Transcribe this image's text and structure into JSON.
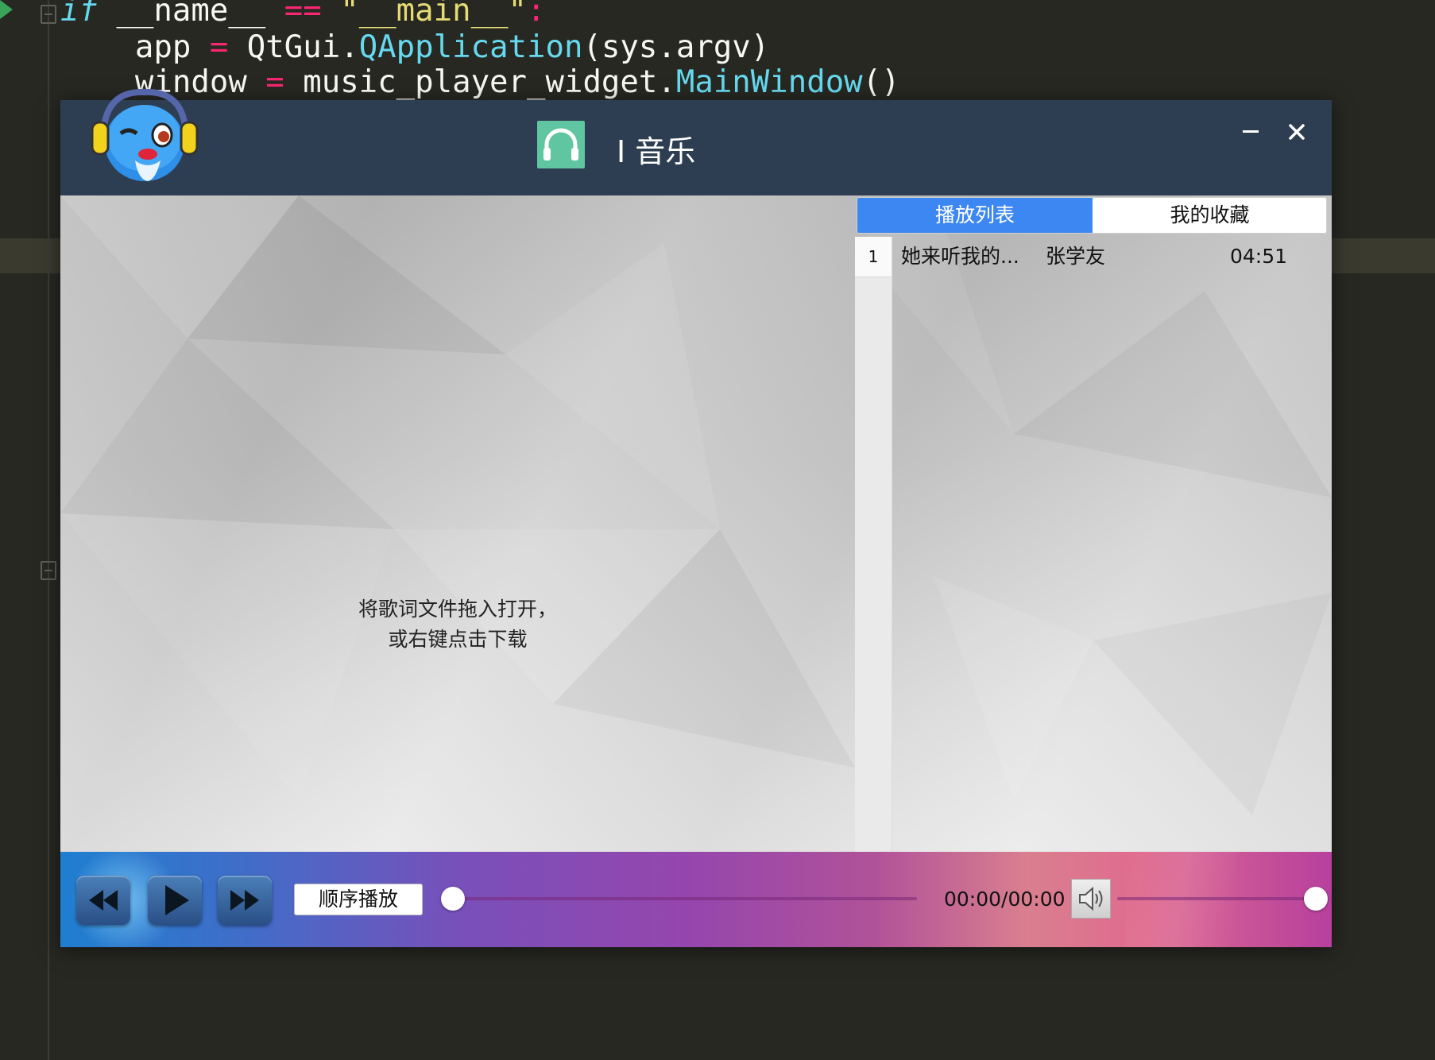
{
  "editor": {
    "code_lines": [
      {
        "kw": "if",
        "a": " __name__ ",
        "op": "==",
        "b": " ",
        "str": "\"__main__\"",
        "c": ":"
      },
      {
        "a": "    app ",
        "op": "=",
        "b": " QtGui.",
        "fn": "QApplication",
        "c": "(sys.argv)"
      },
      {
        "a": "    window ",
        "op": "=",
        "b": " music_player_widget.",
        "fn": "MainWindow",
        "c": "()"
      }
    ]
  },
  "player": {
    "title": "I 音乐",
    "tabs": [
      {
        "label": "播放列表",
        "active": true
      },
      {
        "label": "我的收藏",
        "active": false
      }
    ],
    "playlist": [
      {
        "index": "1",
        "song": "她来听我的...",
        "artist": "张学友",
        "duration": "04:51"
      }
    ],
    "lyrics_hint": [
      "将歌词文件拖入打开，",
      "或右键点击下载"
    ],
    "controls": {
      "play_mode": "顺序播放",
      "time": "00:00/00:00",
      "progress": 0,
      "volume": 1.0
    },
    "colors": {
      "titlebar": "#2e3e52",
      "tab_active": "#3d87f2",
      "logo": "#5fc6a1"
    },
    "icons": [
      "mascot",
      "headphones-icon",
      "minimize-icon",
      "close-icon",
      "rewind-icon",
      "play-icon",
      "fast-forward-icon",
      "volume-icon"
    ]
  }
}
